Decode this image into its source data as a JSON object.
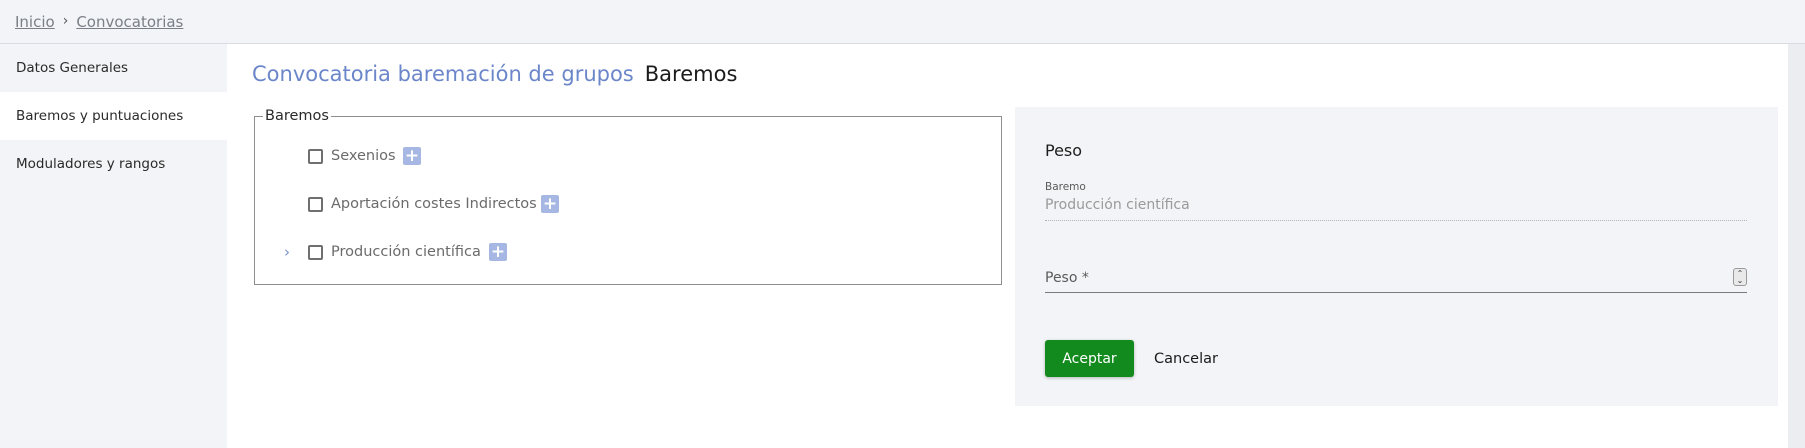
{
  "breadcrumb": {
    "items": [
      "Inicio",
      "Convocatorias"
    ],
    "separator_icon": "chevron-right"
  },
  "sidebar": {
    "items": [
      {
        "label": "Datos Generales",
        "active": false
      },
      {
        "label": "Baremos y puntuaciones",
        "active": true
      },
      {
        "label": "Moduladores y rangos",
        "active": false
      }
    ]
  },
  "header": {
    "crumb_title": "Convocatoria baremación de grupos",
    "page_title": "Baremos"
  },
  "tree": {
    "legend": "Baremos",
    "items": [
      {
        "label": "Sexenios",
        "expandable": false,
        "checked": false
      },
      {
        "label": "Aportación costes Indirectos",
        "expandable": false,
        "checked": false
      },
      {
        "label": "Producción científica",
        "expandable": true,
        "checked": false
      }
    ],
    "add_icon": "plus"
  },
  "form": {
    "title": "Peso",
    "baremo_label": "Baremo",
    "baremo_value": "Producción científica",
    "peso_label": "Peso *",
    "accept_label": "Aceptar",
    "cancel_label": "Cancelar"
  },
  "colors": {
    "accent": "#6b86c9",
    "add_button": "#a6b7e3",
    "accept_button": "#138a1e",
    "panel_bg": "#f2f4f7"
  }
}
